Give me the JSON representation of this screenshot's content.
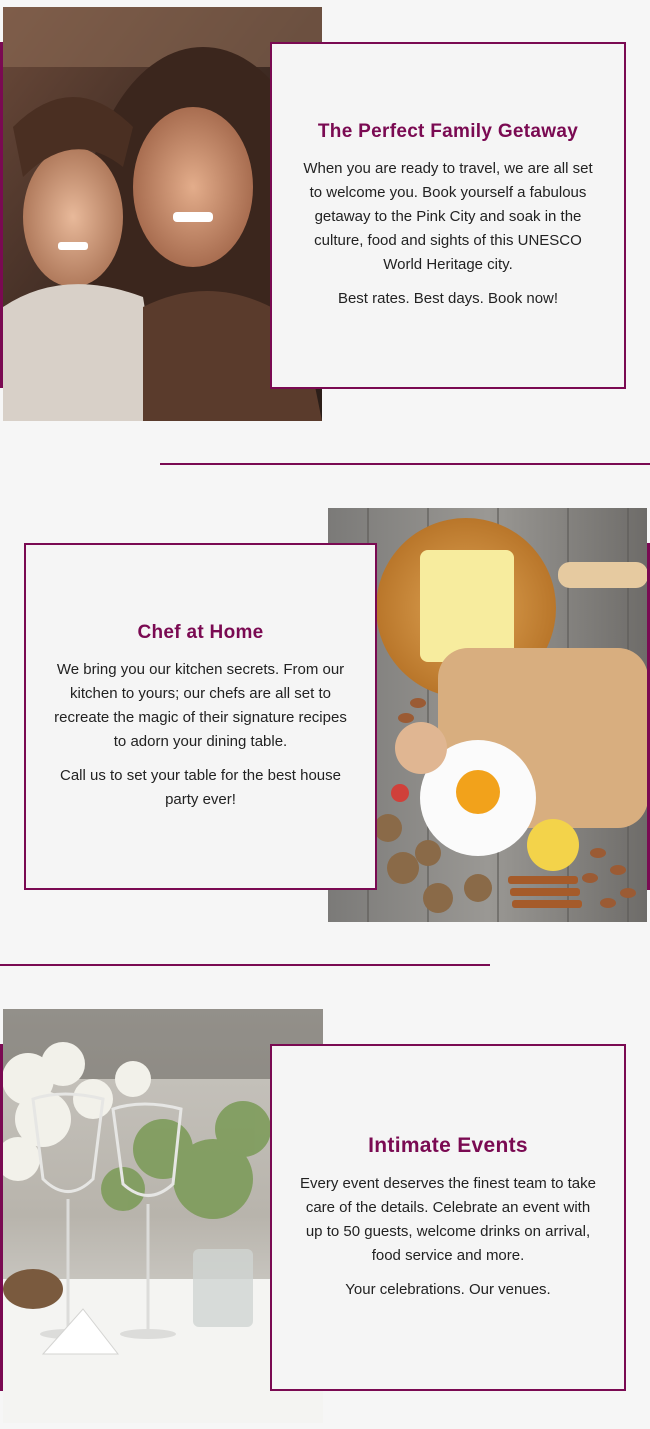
{
  "colors": {
    "accent": "#7a0a52",
    "background": "#f6f6f6",
    "card": "#f5f5f5"
  },
  "sections": [
    {
      "title": "The Perfect Family Getaway",
      "body": "When you are ready to travel, we are all set to welcome you. Book yourself a fabulous getaway to the Pink City and soak in the culture, food and sights of this UNESCO World Heritage city.",
      "cta": "Best rates. Best days. Book now!",
      "image": "couple-smiling-photo"
    },
    {
      "title": "Chef at Home",
      "body": "We bring you our kitchen secrets. From our kitchen to yours; our chefs are all set to recreate the magic of their signature recipes to adorn your dining table.",
      "cta": "Call us to set your table for the best house party ever!",
      "image": "baking-ingredients-photo"
    },
    {
      "title": "Intimate Events",
      "body": "Every event deserves the finest team to take care of the details. Celebrate an event with up to 50 guests, welcome drinks on arrival, food service and more.",
      "cta": "Your celebrations. Our venues.",
      "image": "wine-glasses-table-photo"
    }
  ]
}
